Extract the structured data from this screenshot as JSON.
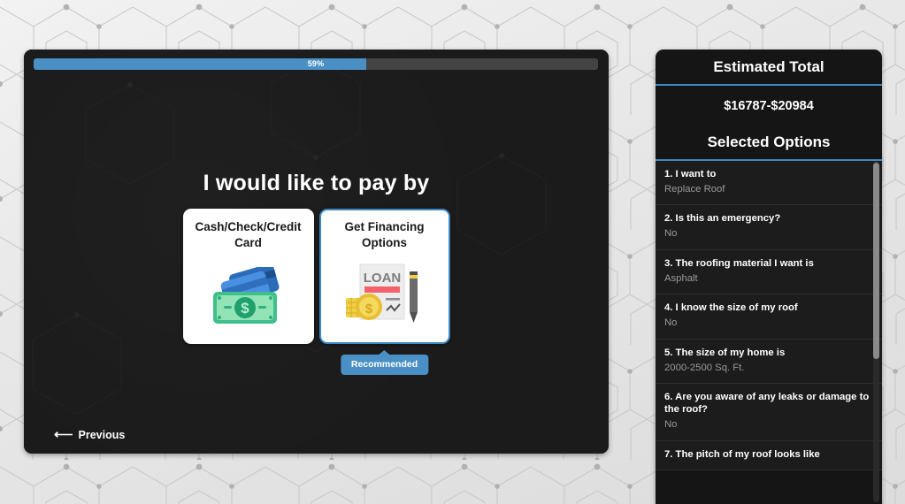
{
  "progress": {
    "percent_label": "59%",
    "percent_value": 59,
    "fill_color": "#4a90c4",
    "track_color": "#444444"
  },
  "main": {
    "question": "I would like to pay by",
    "options": [
      {
        "label": "Cash/Check/Credit Card",
        "icon": "cash-credit-card-icon",
        "selected": false,
        "recommended": false
      },
      {
        "label": "Get Financing Options",
        "icon": "loan-document-coins-pen-icon",
        "selected": true,
        "recommended": true,
        "badge_label": "Recommended"
      }
    ],
    "previous_label": "Previous",
    "previous_arrow": "⟵"
  },
  "sidebar": {
    "total_header": "Estimated Total",
    "total_amount": "$16787-$20984",
    "options_header": "Selected Options",
    "accent_color": "#3d88c4",
    "items": [
      {
        "question": "1. I want to",
        "answer": "Replace Roof"
      },
      {
        "question": "2. Is this an emergency?",
        "answer": "No"
      },
      {
        "question": "3. The roofing material I want is",
        "answer": "Asphalt"
      },
      {
        "question": "4. I know the size of my roof",
        "answer": "No"
      },
      {
        "question": "5. The size of my home is",
        "answer": "2000-2500 Sq. Ft."
      },
      {
        "question": "6. Are you aware of any leaks or damage to the roof?",
        "answer": "No"
      },
      {
        "question": "7. The pitch of my roof looks like",
        "answer": ""
      }
    ]
  }
}
